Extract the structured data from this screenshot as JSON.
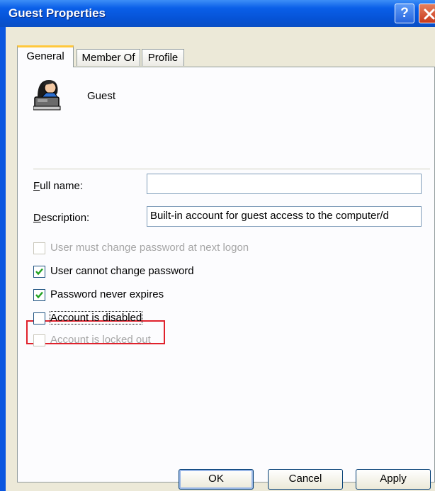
{
  "window": {
    "title": "Guest Properties",
    "help_label": "?",
    "accent": "#0a56e0"
  },
  "tabs": [
    {
      "label": "General",
      "active": true
    },
    {
      "label": "Member Of",
      "active": false
    },
    {
      "label": "Profile",
      "active": false
    }
  ],
  "general": {
    "account_name": "Guest",
    "account_icon": "user-account-icon",
    "full_name_label": "Full name:",
    "full_name_value": "",
    "description_label": "Description:",
    "description_value": "Built-in account for guest access to the computer/d"
  },
  "checkboxes": [
    {
      "label": "User must change password at next logon",
      "checked": false,
      "enabled": false
    },
    {
      "label": "User cannot change password",
      "checked": true,
      "enabled": true
    },
    {
      "label": "Password never expires",
      "checked": true,
      "enabled": true
    },
    {
      "label": "Account is disabled",
      "checked": false,
      "enabled": true,
      "highlighted": true
    },
    {
      "label": "Account is locked out",
      "checked": false,
      "enabled": false
    }
  ],
  "buttons": {
    "ok": "OK",
    "cancel": "Cancel",
    "apply": "Apply"
  }
}
